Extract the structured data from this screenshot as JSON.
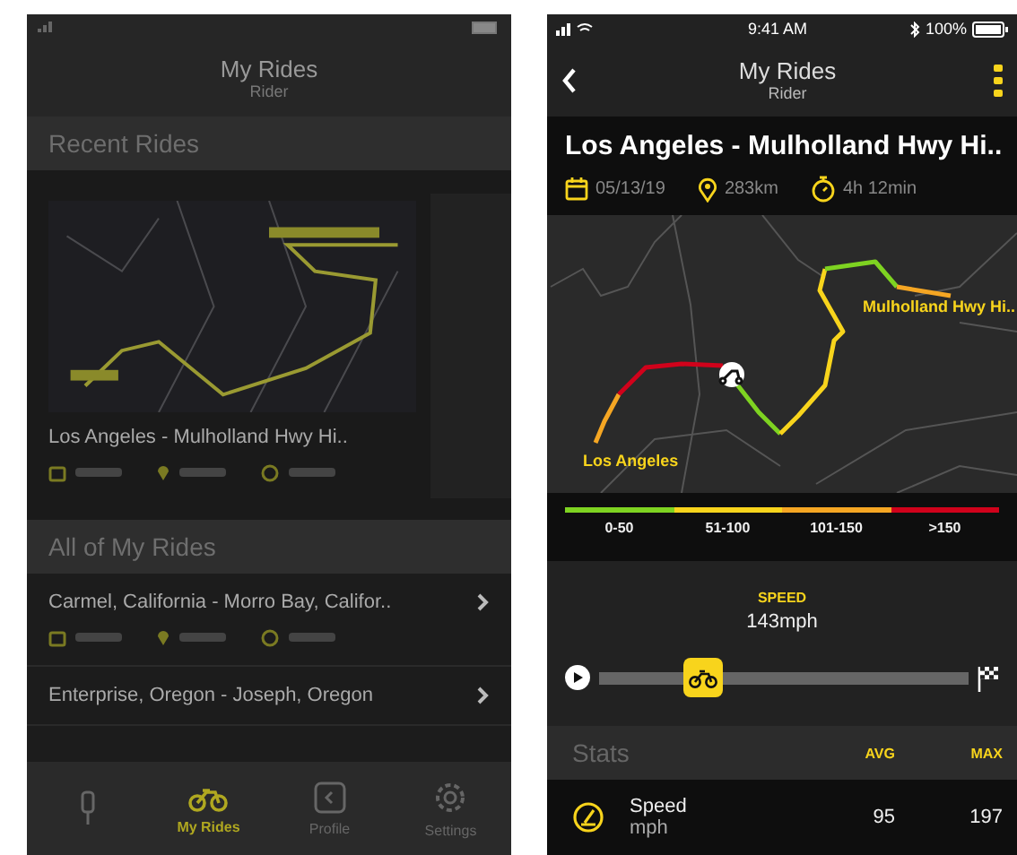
{
  "list_screen": {
    "header": {
      "title": "My Rides",
      "subtitle": "Rider"
    },
    "recent_rides": {
      "heading": "Recent Rides",
      "cards": [
        {
          "title": "Los Angeles - Mulholland Hwy Hi.."
        }
      ]
    },
    "all_rides": {
      "heading": "All of My Rides",
      "rows": [
        {
          "title": "Carmel, California - Morro Bay, Califor..",
          "meta": true
        },
        {
          "title": "Enterprise, Oregon - Joseph, Oregon",
          "meta": false
        }
      ]
    },
    "tab_bar": [
      {
        "kind": "spark",
        "selected": false
      },
      {
        "kind": "bike",
        "label": "My Rides",
        "selected": true
      },
      {
        "kind": "profile",
        "label": "Profile",
        "selected": false
      },
      {
        "kind": "gear",
        "label": "Settings",
        "selected": false
      }
    ]
  },
  "detail_screen": {
    "status_bar": {
      "time": "9:41 AM",
      "battery": "100%"
    },
    "header": {
      "title": "My Rides",
      "subtitle": "Rider"
    },
    "ride": {
      "title": "Los Angeles - Mulholland Hwy Hi..",
      "date": "05/13/19",
      "distance": "283km",
      "duration": "4h 12min"
    },
    "map": {
      "destination_label": "Mulholland Hwy Hi..",
      "origin_label": "Los Angeles"
    },
    "speed_legend": [
      {
        "label": "0-50",
        "color": "#7ed321"
      },
      {
        "label": "51-100",
        "color": "#f8d41c"
      },
      {
        "label": "101-150",
        "color": "#f5a623"
      },
      {
        "label": ">150",
        "color": "#d0021b"
      }
    ],
    "playback": {
      "label": "SPEED",
      "value": "143mph",
      "level": 0.28
    },
    "stats": {
      "heading": "Stats",
      "columns": [
        "AVG",
        "MAX"
      ],
      "rows": [
        {
          "name": "Speed",
          "unit": "mph",
          "avg": "95",
          "max": "197"
        }
      ]
    }
  }
}
